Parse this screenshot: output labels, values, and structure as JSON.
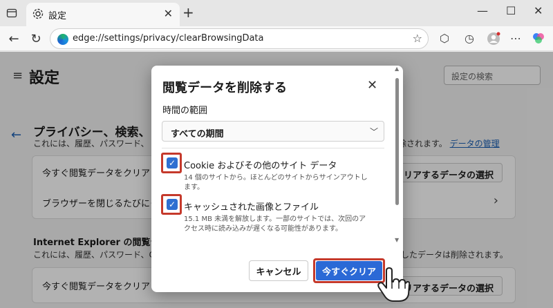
{
  "browser": {
    "tab_title": "設定",
    "url": "edge://settings/privacy/clearBrowsingData"
  },
  "page": {
    "title": "設定",
    "search_placeholder": "設定の検索",
    "section_title": "プライバシー、検索、",
    "section_desc": "これには、履歴、パスワード、",
    "section_desc_right": "除されます。",
    "manage_link": "データの管理",
    "row1_label": "今すぐ閲覧データをクリア",
    "row1_button": "クリアするデータの選択",
    "row2_label": "ブラウザーを閉じるたびにク",
    "ie_title": "Internet Explorer の閲覧デー",
    "ie_desc": "これには、履歴、パスワード、Coo",
    "ie_desc_right": "したデータは削除されます。",
    "ie_row_label": "今すぐ閲覧データをクリア",
    "ie_row_button": "クリアするデータの選択"
  },
  "dialog": {
    "title": "閲覧データを削除する",
    "range_label": "時間の範囲",
    "range_value": "すべての期間",
    "options": [
      {
        "title": "Cookie およびその他のサイト データ",
        "subtitle": "14 個のサイトから。ほとんどのサイトからサインアウトします。",
        "checked": true
      },
      {
        "title": "キャッシュされた画像とファイル",
        "subtitle": "15.1 MB 未満を解放します。一部のサイトでは、次回のアクセス時に読み込みが遅くなる可能性があります。",
        "checked": true
      }
    ],
    "cancel_label": "キャンセル",
    "clear_label": "今すぐクリア"
  },
  "colors": {
    "accent": "#2b69d6",
    "highlight": "#c5392b",
    "checkbox": "#2f6fd1"
  }
}
